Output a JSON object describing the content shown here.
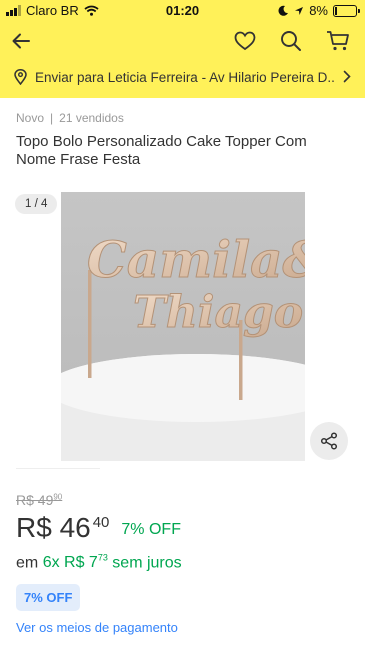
{
  "status_bar": {
    "carrier": "Claro BR",
    "time": "01:20",
    "battery": "8%",
    "icons": [
      "signal-icon",
      "wifi-icon",
      "moon-icon",
      "location-arrow-icon",
      "battery-icon"
    ]
  },
  "nav": {
    "icons": [
      "back-arrow-icon",
      "heart-icon",
      "search-icon",
      "cart-icon"
    ]
  },
  "address": {
    "text": "Enviar para Leticia Ferreira - Av Hilario Pereira D..."
  },
  "product": {
    "condition": "Novo",
    "separator": "|",
    "sold": "21 vendidos",
    "title": "Topo Bolo Personalizado Cake Topper Com Nome Frase Festa"
  },
  "gallery": {
    "counter": "1 / 4",
    "topper_line1": "Camila&",
    "topper_line2": "Thiago"
  },
  "pricing": {
    "old_currency": "R$ 49",
    "old_cents": "90",
    "currency": "R$ 46",
    "cents": "40",
    "discount": "7% OFF",
    "installment_prefix": "em",
    "installment_value": "6x R$ 7",
    "installment_cents": "73",
    "installment_suffix": "sem juros",
    "badge": "7% OFF",
    "payments_link": "Ver os meios de pagamento"
  },
  "colors": {
    "header_yellow": "#fff159",
    "link_blue": "#3483fa",
    "green": "#00a650"
  }
}
